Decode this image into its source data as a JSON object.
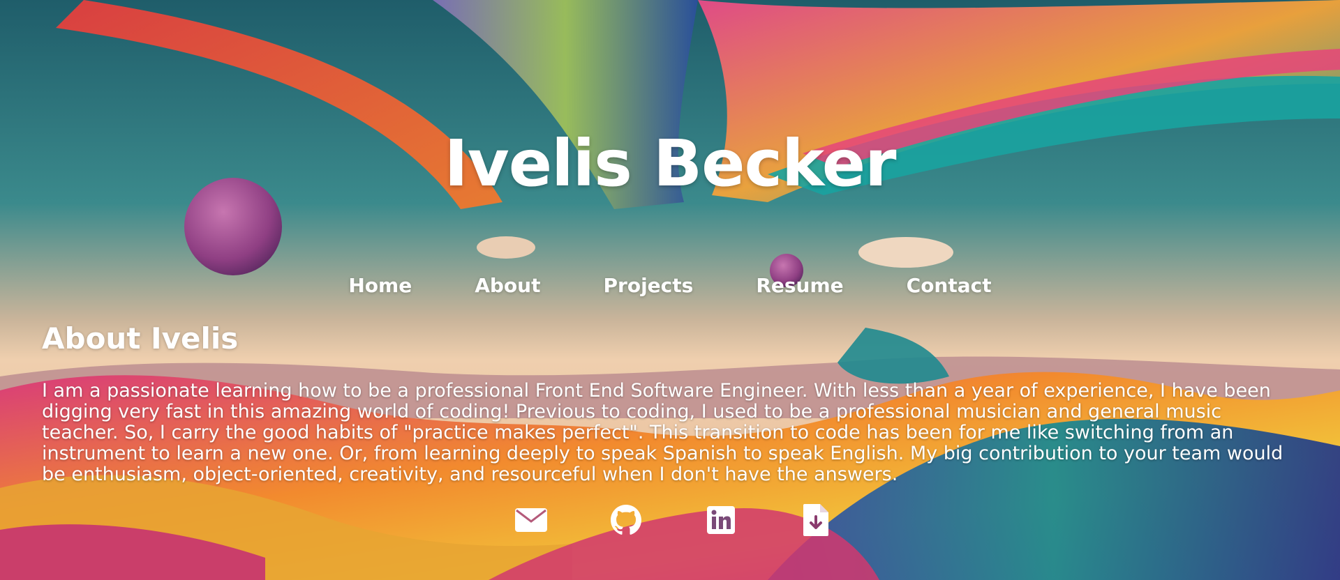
{
  "header": {
    "title": "Ivelis Becker"
  },
  "nav": {
    "items": [
      {
        "label": "Home"
      },
      {
        "label": "About"
      },
      {
        "label": "Projects"
      },
      {
        "label": "Resume"
      },
      {
        "label": "Contact"
      }
    ]
  },
  "about": {
    "heading": "About Ivelis",
    "body": "I am a passionate learning how to be a professional Front End Software Engineer. With less than a year of experience, I have been digging very fast in this amazing world of coding! Previous to coding, I used to be a professional musician and general music teacher. So, I carry the good habits of \"practice makes perfect\". This transition to code has been for me like switching from an instrument to learn a new one. Or, from learning deeply to speak Spanish to speak English. My big contribution to your team would be enthusiasm, object-oriented, creativity, and resourceful when I don't have the answers."
  },
  "socials": [
    {
      "icon": "envelope-icon"
    },
    {
      "icon": "github-icon"
    },
    {
      "icon": "linkedin-icon"
    },
    {
      "icon": "file-download-icon"
    }
  ],
  "colors": {
    "text": "#ffffff",
    "sky_top": "#2f6f78",
    "sky_horizon": "#e8c9a8",
    "ground_pink": "#d8357a",
    "ground_orange": "#f08a2a",
    "ground_teal": "#1f8a8f",
    "planet": "#a04a8a"
  }
}
